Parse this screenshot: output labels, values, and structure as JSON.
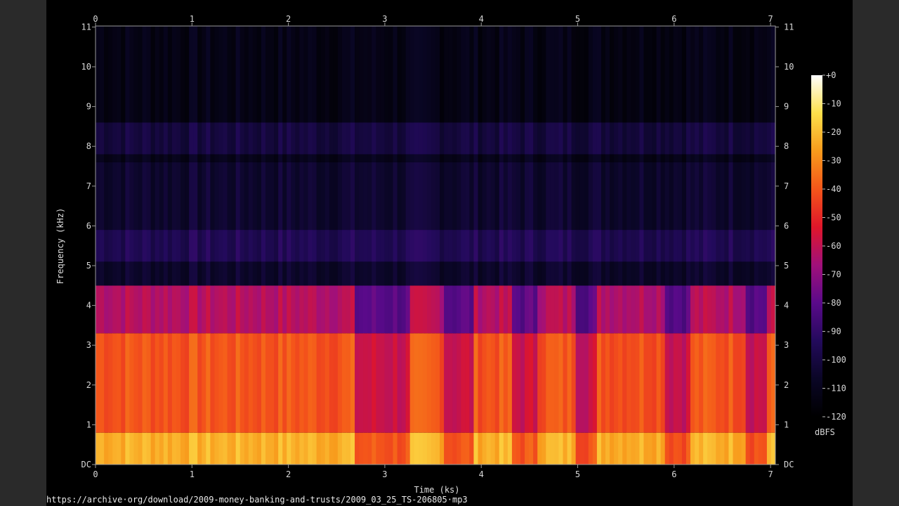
{
  "source_url": "https://archive·org/download/2009-money-banking-and-trusts/2009_03_25_TS-206805·mp3",
  "colors": {
    "background": "#000000",
    "frame_side": "#2a2a2a",
    "text": "#d8d8d8",
    "colormap": [
      "#000000",
      "#0a0626",
      "#230a5c",
      "#5a0a8a",
      "#a0107a",
      "#e0162a",
      "#f4561a",
      "#f89b1c",
      "#fde04a",
      "#ffffff"
    ]
  },
  "chart_data": {
    "type": "heatmap",
    "title": "",
    "xlabel": "Time (ks)",
    "ylabel": "Frequency (kHz)",
    "xlim": [
      0,
      7.05
    ],
    "ylim": [
      0,
      11.025
    ],
    "x_ticks": [
      "0",
      "1",
      "2",
      "3",
      "4",
      "5",
      "6",
      "7"
    ],
    "y_ticks": [
      "DC",
      "1",
      "2",
      "3",
      "4",
      "5",
      "6",
      "7",
      "8",
      "9",
      "10",
      "11"
    ],
    "colorbar": {
      "label": "dBFS",
      "range": [
        -120,
        0
      ],
      "ticks": [
        "+0",
        "-10",
        "-20",
        "-30",
        "-40",
        "-50",
        "-60",
        "-70",
        "-80",
        "-90",
        "-100",
        "-110",
        "-120"
      ]
    },
    "frequency_bands_dbfs": [
      {
        "freq_khz": [
          0,
          0.8
        ],
        "level": -22
      },
      {
        "freq_khz": [
          0.8,
          3.3
        ],
        "level": -40
      },
      {
        "freq_khz": [
          3.3,
          4.5
        ],
        "level": -62
      },
      {
        "freq_khz": [
          4.5,
          5.1
        ],
        "level": -105
      },
      {
        "freq_khz": [
          5.1,
          5.9
        ],
        "level": -95
      },
      {
        "freq_khz": [
          5.9,
          7.6
        ],
        "level": -104
      },
      {
        "freq_khz": [
          7.6,
          7.8
        ],
        "level": -110
      },
      {
        "freq_khz": [
          7.8,
          8.6
        ],
        "level": -100
      },
      {
        "freq_khz": [
          8.6,
          11.025
        ],
        "level": -112
      }
    ],
    "quiet_segments_ks": [
      [
        2.7,
        3.25
      ],
      [
        3.6,
        3.9
      ],
      [
        4.3,
        4.6
      ],
      [
        5.0,
        5.2
      ],
      [
        5.9,
        6.15
      ],
      [
        6.75,
        6.95
      ]
    ]
  }
}
